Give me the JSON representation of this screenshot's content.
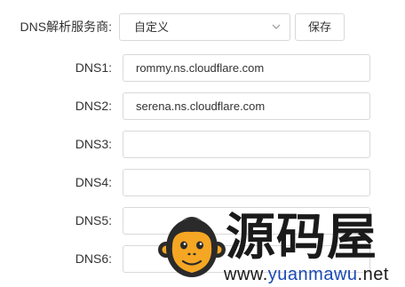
{
  "provider": {
    "label": "DNS解析服务商:",
    "selected": "自定义",
    "save_label": "保存"
  },
  "dns": [
    {
      "label": "DNS1:",
      "value": "rommy.ns.cloudflare.com"
    },
    {
      "label": "DNS2:",
      "value": "serena.ns.cloudflare.com"
    },
    {
      "label": "DNS3:",
      "value": ""
    },
    {
      "label": "DNS4:",
      "value": ""
    },
    {
      "label": "DNS5:",
      "value": ""
    },
    {
      "label": "DNS6:",
      "value": ""
    }
  ],
  "watermark": {
    "title": "源码屋",
    "url_prefix": "www.",
    "url_mid": "yuanmawu",
    "url_suffix": ".net"
  },
  "colors": {
    "border": "#d9d9d9",
    "text": "#333333",
    "watermark_accent": "#1a49b4",
    "watermark_logo": "#f5a623"
  },
  "icons": {
    "select_arrow": "chevron-down-icon",
    "watermark_logo": "monkey-face-logo"
  }
}
